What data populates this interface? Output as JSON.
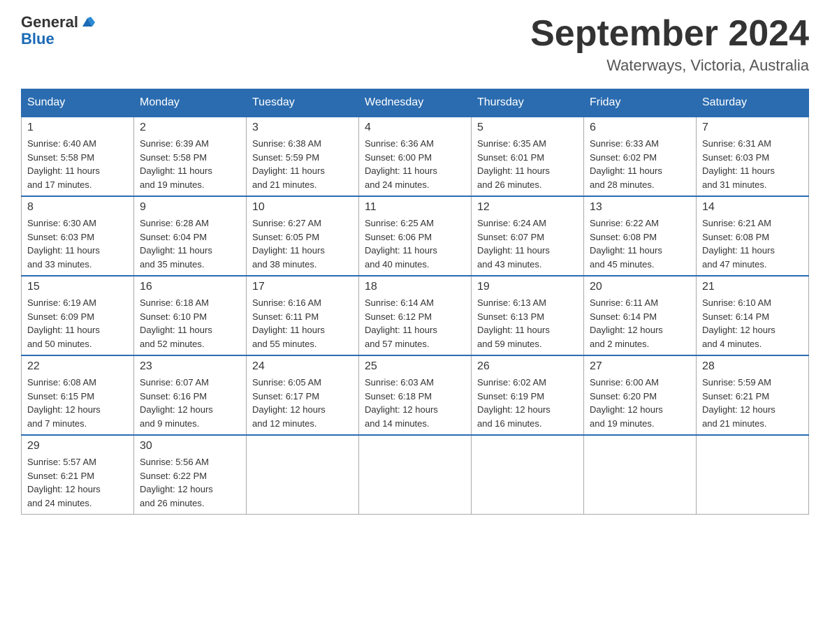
{
  "logo": {
    "general": "General",
    "blue": "Blue"
  },
  "title": "September 2024",
  "location": "Waterways, Victoria, Australia",
  "days_of_week": [
    "Sunday",
    "Monday",
    "Tuesday",
    "Wednesday",
    "Thursday",
    "Friday",
    "Saturday"
  ],
  "weeks": [
    [
      {
        "day": "1",
        "sunrise": "6:40 AM",
        "sunset": "5:58 PM",
        "daylight": "11 hours and 17 minutes."
      },
      {
        "day": "2",
        "sunrise": "6:39 AM",
        "sunset": "5:58 PM",
        "daylight": "11 hours and 19 minutes."
      },
      {
        "day": "3",
        "sunrise": "6:38 AM",
        "sunset": "5:59 PM",
        "daylight": "11 hours and 21 minutes."
      },
      {
        "day": "4",
        "sunrise": "6:36 AM",
        "sunset": "6:00 PM",
        "daylight": "11 hours and 24 minutes."
      },
      {
        "day": "5",
        "sunrise": "6:35 AM",
        "sunset": "6:01 PM",
        "daylight": "11 hours and 26 minutes."
      },
      {
        "day": "6",
        "sunrise": "6:33 AM",
        "sunset": "6:02 PM",
        "daylight": "11 hours and 28 minutes."
      },
      {
        "day": "7",
        "sunrise": "6:31 AM",
        "sunset": "6:03 PM",
        "daylight": "11 hours and 31 minutes."
      }
    ],
    [
      {
        "day": "8",
        "sunrise": "6:30 AM",
        "sunset": "6:03 PM",
        "daylight": "11 hours and 33 minutes."
      },
      {
        "day": "9",
        "sunrise": "6:28 AM",
        "sunset": "6:04 PM",
        "daylight": "11 hours and 35 minutes."
      },
      {
        "day": "10",
        "sunrise": "6:27 AM",
        "sunset": "6:05 PM",
        "daylight": "11 hours and 38 minutes."
      },
      {
        "day": "11",
        "sunrise": "6:25 AM",
        "sunset": "6:06 PM",
        "daylight": "11 hours and 40 minutes."
      },
      {
        "day": "12",
        "sunrise": "6:24 AM",
        "sunset": "6:07 PM",
        "daylight": "11 hours and 43 minutes."
      },
      {
        "day": "13",
        "sunrise": "6:22 AM",
        "sunset": "6:08 PM",
        "daylight": "11 hours and 45 minutes."
      },
      {
        "day": "14",
        "sunrise": "6:21 AM",
        "sunset": "6:08 PM",
        "daylight": "11 hours and 47 minutes."
      }
    ],
    [
      {
        "day": "15",
        "sunrise": "6:19 AM",
        "sunset": "6:09 PM",
        "daylight": "11 hours and 50 minutes."
      },
      {
        "day": "16",
        "sunrise": "6:18 AM",
        "sunset": "6:10 PM",
        "daylight": "11 hours and 52 minutes."
      },
      {
        "day": "17",
        "sunrise": "6:16 AM",
        "sunset": "6:11 PM",
        "daylight": "11 hours and 55 minutes."
      },
      {
        "day": "18",
        "sunrise": "6:14 AM",
        "sunset": "6:12 PM",
        "daylight": "11 hours and 57 minutes."
      },
      {
        "day": "19",
        "sunrise": "6:13 AM",
        "sunset": "6:13 PM",
        "daylight": "11 hours and 59 minutes."
      },
      {
        "day": "20",
        "sunrise": "6:11 AM",
        "sunset": "6:14 PM",
        "daylight": "12 hours and 2 minutes."
      },
      {
        "day": "21",
        "sunrise": "6:10 AM",
        "sunset": "6:14 PM",
        "daylight": "12 hours and 4 minutes."
      }
    ],
    [
      {
        "day": "22",
        "sunrise": "6:08 AM",
        "sunset": "6:15 PM",
        "daylight": "12 hours and 7 minutes."
      },
      {
        "day": "23",
        "sunrise": "6:07 AM",
        "sunset": "6:16 PM",
        "daylight": "12 hours and 9 minutes."
      },
      {
        "day": "24",
        "sunrise": "6:05 AM",
        "sunset": "6:17 PM",
        "daylight": "12 hours and 12 minutes."
      },
      {
        "day": "25",
        "sunrise": "6:03 AM",
        "sunset": "6:18 PM",
        "daylight": "12 hours and 14 minutes."
      },
      {
        "day": "26",
        "sunrise": "6:02 AM",
        "sunset": "6:19 PM",
        "daylight": "12 hours and 16 minutes."
      },
      {
        "day": "27",
        "sunrise": "6:00 AM",
        "sunset": "6:20 PM",
        "daylight": "12 hours and 19 minutes."
      },
      {
        "day": "28",
        "sunrise": "5:59 AM",
        "sunset": "6:21 PM",
        "daylight": "12 hours and 21 minutes."
      }
    ],
    [
      {
        "day": "29",
        "sunrise": "5:57 AM",
        "sunset": "6:21 PM",
        "daylight": "12 hours and 24 minutes."
      },
      {
        "day": "30",
        "sunrise": "5:56 AM",
        "sunset": "6:22 PM",
        "daylight": "12 hours and 26 minutes."
      },
      null,
      null,
      null,
      null,
      null
    ]
  ]
}
